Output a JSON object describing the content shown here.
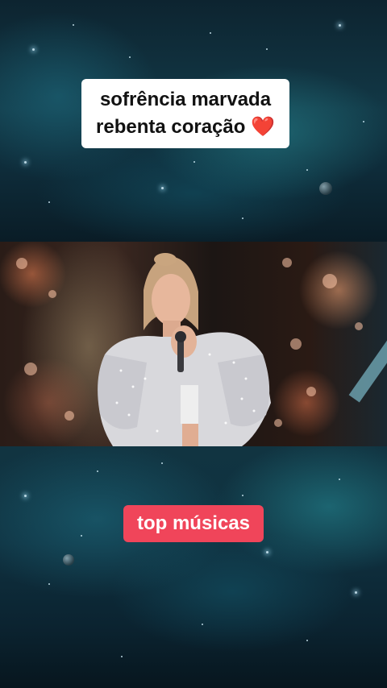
{
  "caption": {
    "line1": "sofrência marvada",
    "line2": "rebenta coração",
    "emoji": "❤️"
  },
  "badge": {
    "label": "top músicas"
  },
  "colors": {
    "badge_bg": "#f0455a",
    "caption_bg": "#ffffff",
    "heart": "#d81b2c",
    "space_teal": "#123846"
  },
  "icons": [
    "heart-icon"
  ]
}
